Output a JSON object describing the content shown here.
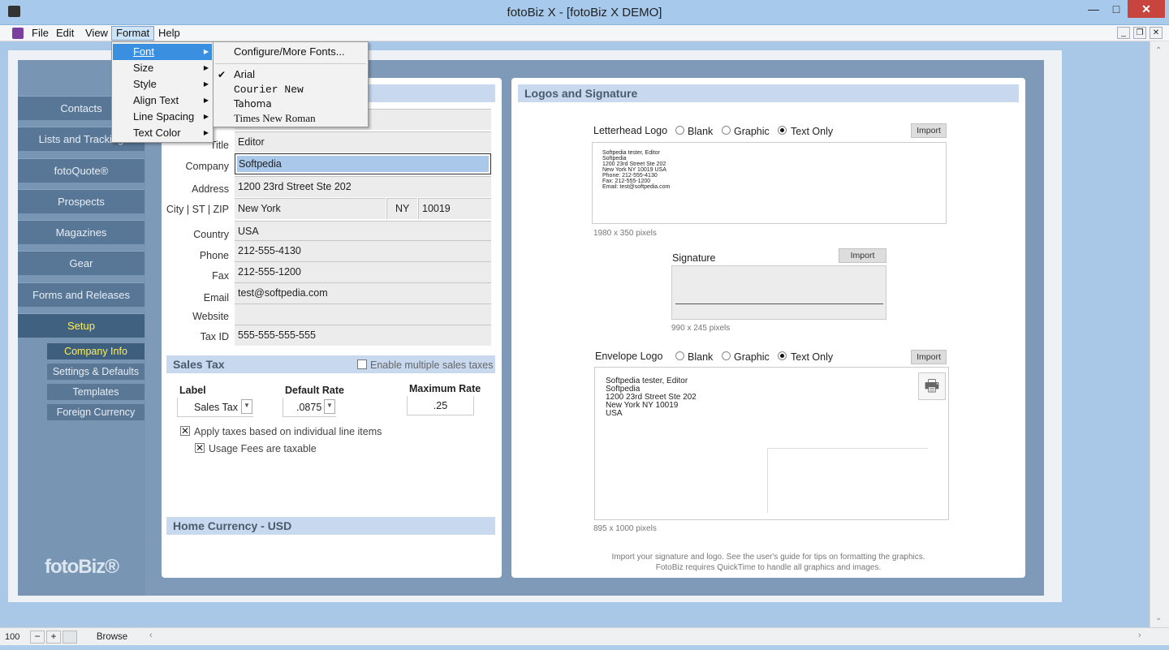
{
  "window": {
    "title": "fotoBiz X - [fotoBiz X DEMO]",
    "minimize": "—",
    "maximize": "□",
    "close": "✕"
  },
  "menubar": {
    "items": [
      "File",
      "Edit",
      "View",
      "Format",
      "Help"
    ]
  },
  "nav": {
    "items": [
      "Contacts",
      "Lists and Tracking",
      "fotoQuote®",
      "Prospects",
      "Magazines",
      "Gear",
      "Forms and Releases",
      "Setup"
    ],
    "subitems": [
      "Company Info",
      "Settings & Defaults",
      "Templates",
      "Foreign Currency"
    ],
    "brand": "fotoBiz®"
  },
  "company": {
    "fields": [
      {
        "label": "Title",
        "value": "Editor"
      },
      {
        "label": "Company",
        "value": "Softpedia"
      },
      {
        "label": "Address",
        "value": "1200 23rd Street Ste 202"
      },
      {
        "label": "City | ST | ZIP",
        "value": "New York",
        "state": "NY",
        "zip": "10019"
      },
      {
        "label": "Country",
        "value": "USA"
      },
      {
        "label": "Phone",
        "value": "212-555-4130"
      },
      {
        "label": "Fax",
        "value": "212-555-1200"
      },
      {
        "label": "Email",
        "value": "test@softpedia.com"
      },
      {
        "label": "Website",
        "value": ""
      },
      {
        "label": "Tax ID",
        "value": "555-555-555-555"
      }
    ]
  },
  "salestax": {
    "header": "Sales Tax",
    "enable_multiple": "Enable multiple sales taxes",
    "col_label": "Label",
    "col_default": "Default Rate",
    "col_max": "Maximum Rate",
    "label_value": "Sales Tax",
    "default_value": ".0875",
    "max_value": ".25",
    "apply_line_items": "Apply taxes based on individual line items",
    "usage_fees": "Usage Fees are taxable"
  },
  "home_currency": "Home Currency - USD",
  "logos": {
    "header": "Logos and Signature",
    "letterhead_label": "Letterhead Logo",
    "envelope_label": "Envelope Logo",
    "signature_label": "Signature",
    "opt_blank": "Blank",
    "opt_graphic": "Graphic",
    "opt_textonly": "Text Only",
    "import": "Import",
    "letterhead_lines": [
      "Softpedia tester, Editor",
      "Softpedia",
      "1200 23rd Street Ste 202",
      "New York NY 10019  USA",
      "Phone: 212-555-4130",
      "Fax: 212-555-1200",
      "Email: test@softpedia.com"
    ],
    "letterhead_size": "1980 x 350 pixels",
    "signature_size": "990 x 245 pixels",
    "envelope_lines": [
      "Softpedia tester, Editor",
      "Softpedia",
      "1200 23rd Street Ste 202",
      "New York NY  10019",
      "USA"
    ],
    "envelope_size": "895 x 1000 pixels",
    "footer1": "Import your signature and logo. See the user's guide for tips on formatting the graphics.",
    "footer2": "FotoBiz requires QuickTime to handle all graphics and images."
  },
  "format_menu": {
    "items": [
      "Font",
      "Size",
      "Style",
      "Align Text",
      "Line Spacing",
      "Text Color"
    ]
  },
  "font_menu": {
    "configure": "Configure/More Fonts...",
    "fonts": [
      "Arial",
      "Courier New",
      "Tahoma",
      "Times New Roman"
    ]
  },
  "statusbar": {
    "zoom": "100",
    "mode": "Browse"
  },
  "colors": {
    "nav_selected_text": "#ffef5a",
    "menu_highlight": "#3a8fe0"
  }
}
